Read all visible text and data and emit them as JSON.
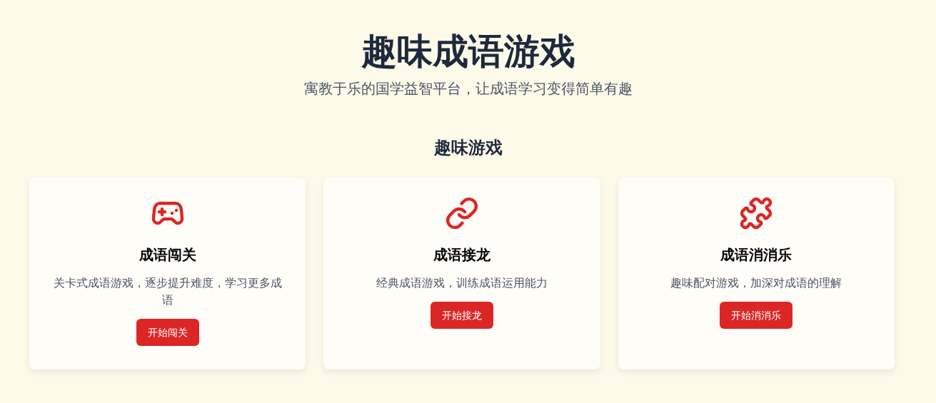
{
  "header": {
    "title": "趣味成语游戏",
    "subtitle": "寓教于乐的国学益智平台，让成语学习变得简单有趣"
  },
  "section": {
    "heading": "趣味游戏"
  },
  "games": [
    {
      "kind": "gamepad",
      "title": "成语闯关",
      "description": "关卡式成语游戏，逐步提升难度，学习更多成语",
      "button": "开始闯关"
    },
    {
      "kind": "link",
      "title": "成语接龙",
      "description": "经典成语游戏，训练成语运用能力",
      "button": "开始接龙"
    },
    {
      "kind": "puzzle",
      "title": "成语消消乐",
      "description": "趣味配对游戏，加深对成语的理解",
      "button": "开始消消乐"
    }
  ]
}
